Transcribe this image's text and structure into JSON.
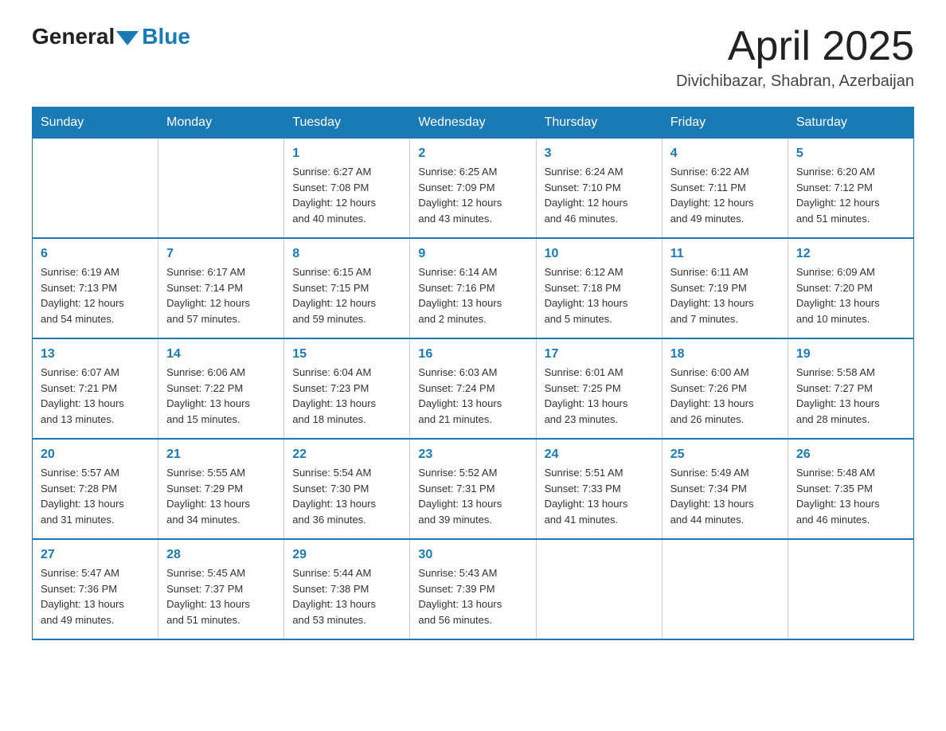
{
  "header": {
    "logo_general": "General",
    "logo_blue": "Blue",
    "month_title": "April 2025",
    "location": "Divichibazar, Shabran, Azerbaijan"
  },
  "weekdays": [
    "Sunday",
    "Monday",
    "Tuesday",
    "Wednesday",
    "Thursday",
    "Friday",
    "Saturday"
  ],
  "weeks": [
    [
      {
        "day": "",
        "info": ""
      },
      {
        "day": "",
        "info": ""
      },
      {
        "day": "1",
        "info": "Sunrise: 6:27 AM\nSunset: 7:08 PM\nDaylight: 12 hours\nand 40 minutes."
      },
      {
        "day": "2",
        "info": "Sunrise: 6:25 AM\nSunset: 7:09 PM\nDaylight: 12 hours\nand 43 minutes."
      },
      {
        "day": "3",
        "info": "Sunrise: 6:24 AM\nSunset: 7:10 PM\nDaylight: 12 hours\nand 46 minutes."
      },
      {
        "day": "4",
        "info": "Sunrise: 6:22 AM\nSunset: 7:11 PM\nDaylight: 12 hours\nand 49 minutes."
      },
      {
        "day": "5",
        "info": "Sunrise: 6:20 AM\nSunset: 7:12 PM\nDaylight: 12 hours\nand 51 minutes."
      }
    ],
    [
      {
        "day": "6",
        "info": "Sunrise: 6:19 AM\nSunset: 7:13 PM\nDaylight: 12 hours\nand 54 minutes."
      },
      {
        "day": "7",
        "info": "Sunrise: 6:17 AM\nSunset: 7:14 PM\nDaylight: 12 hours\nand 57 minutes."
      },
      {
        "day": "8",
        "info": "Sunrise: 6:15 AM\nSunset: 7:15 PM\nDaylight: 12 hours\nand 59 minutes."
      },
      {
        "day": "9",
        "info": "Sunrise: 6:14 AM\nSunset: 7:16 PM\nDaylight: 13 hours\nand 2 minutes."
      },
      {
        "day": "10",
        "info": "Sunrise: 6:12 AM\nSunset: 7:18 PM\nDaylight: 13 hours\nand 5 minutes."
      },
      {
        "day": "11",
        "info": "Sunrise: 6:11 AM\nSunset: 7:19 PM\nDaylight: 13 hours\nand 7 minutes."
      },
      {
        "day": "12",
        "info": "Sunrise: 6:09 AM\nSunset: 7:20 PM\nDaylight: 13 hours\nand 10 minutes."
      }
    ],
    [
      {
        "day": "13",
        "info": "Sunrise: 6:07 AM\nSunset: 7:21 PM\nDaylight: 13 hours\nand 13 minutes."
      },
      {
        "day": "14",
        "info": "Sunrise: 6:06 AM\nSunset: 7:22 PM\nDaylight: 13 hours\nand 15 minutes."
      },
      {
        "day": "15",
        "info": "Sunrise: 6:04 AM\nSunset: 7:23 PM\nDaylight: 13 hours\nand 18 minutes."
      },
      {
        "day": "16",
        "info": "Sunrise: 6:03 AM\nSunset: 7:24 PM\nDaylight: 13 hours\nand 21 minutes."
      },
      {
        "day": "17",
        "info": "Sunrise: 6:01 AM\nSunset: 7:25 PM\nDaylight: 13 hours\nand 23 minutes."
      },
      {
        "day": "18",
        "info": "Sunrise: 6:00 AM\nSunset: 7:26 PM\nDaylight: 13 hours\nand 26 minutes."
      },
      {
        "day": "19",
        "info": "Sunrise: 5:58 AM\nSunset: 7:27 PM\nDaylight: 13 hours\nand 28 minutes."
      }
    ],
    [
      {
        "day": "20",
        "info": "Sunrise: 5:57 AM\nSunset: 7:28 PM\nDaylight: 13 hours\nand 31 minutes."
      },
      {
        "day": "21",
        "info": "Sunrise: 5:55 AM\nSunset: 7:29 PM\nDaylight: 13 hours\nand 34 minutes."
      },
      {
        "day": "22",
        "info": "Sunrise: 5:54 AM\nSunset: 7:30 PM\nDaylight: 13 hours\nand 36 minutes."
      },
      {
        "day": "23",
        "info": "Sunrise: 5:52 AM\nSunset: 7:31 PM\nDaylight: 13 hours\nand 39 minutes."
      },
      {
        "day": "24",
        "info": "Sunrise: 5:51 AM\nSunset: 7:33 PM\nDaylight: 13 hours\nand 41 minutes."
      },
      {
        "day": "25",
        "info": "Sunrise: 5:49 AM\nSunset: 7:34 PM\nDaylight: 13 hours\nand 44 minutes."
      },
      {
        "day": "26",
        "info": "Sunrise: 5:48 AM\nSunset: 7:35 PM\nDaylight: 13 hours\nand 46 minutes."
      }
    ],
    [
      {
        "day": "27",
        "info": "Sunrise: 5:47 AM\nSunset: 7:36 PM\nDaylight: 13 hours\nand 49 minutes."
      },
      {
        "day": "28",
        "info": "Sunrise: 5:45 AM\nSunset: 7:37 PM\nDaylight: 13 hours\nand 51 minutes."
      },
      {
        "day": "29",
        "info": "Sunrise: 5:44 AM\nSunset: 7:38 PM\nDaylight: 13 hours\nand 53 minutes."
      },
      {
        "day": "30",
        "info": "Sunrise: 5:43 AM\nSunset: 7:39 PM\nDaylight: 13 hours\nand 56 minutes."
      },
      {
        "day": "",
        "info": ""
      },
      {
        "day": "",
        "info": ""
      },
      {
        "day": "",
        "info": ""
      }
    ]
  ],
  "colors": {
    "header_bg": "#1a7ab5",
    "header_text": "#ffffff",
    "day_number": "#1a7ab5",
    "border": "#1a7ab5"
  }
}
